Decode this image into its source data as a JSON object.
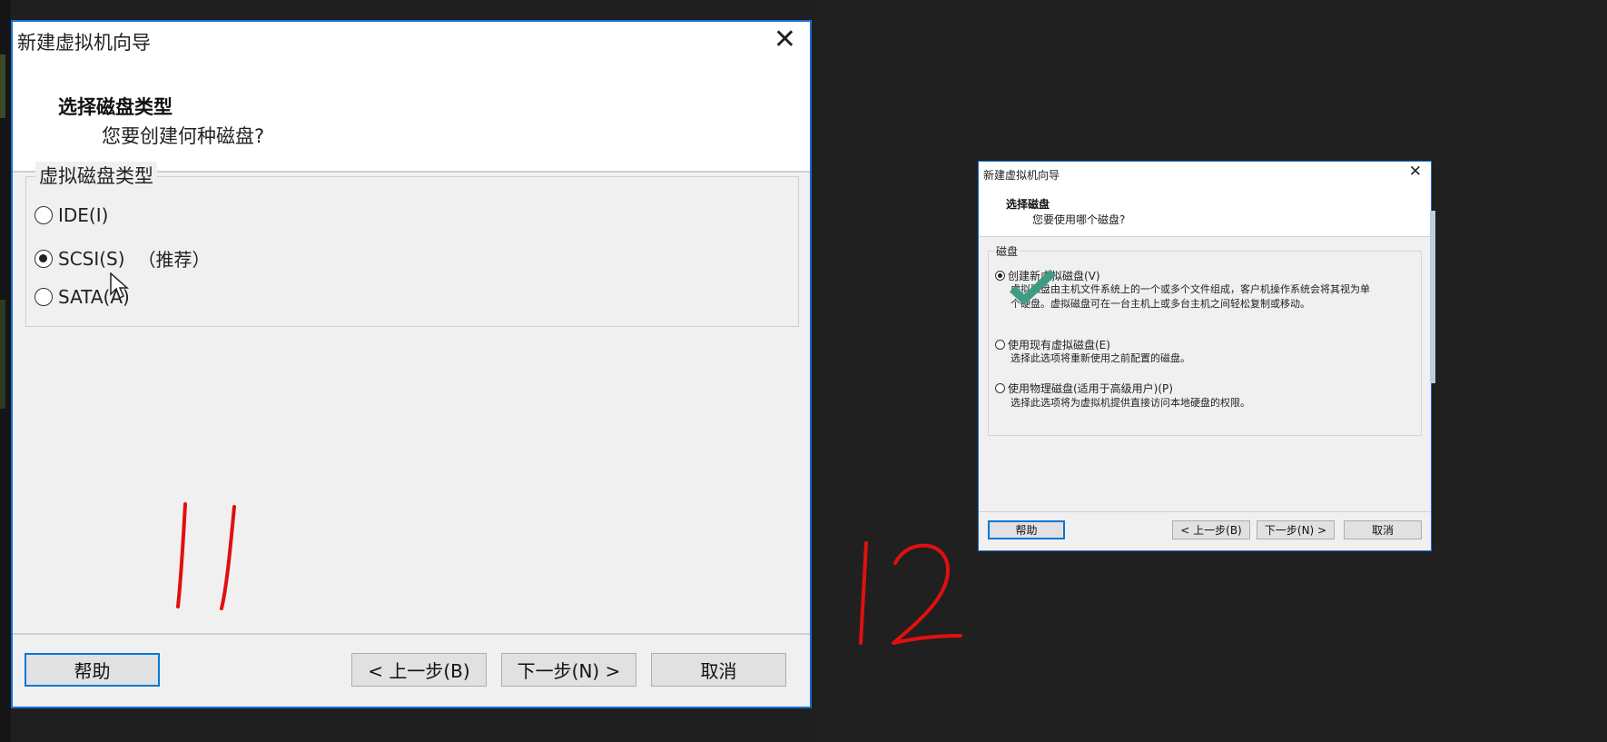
{
  "dialog1": {
    "title": "新建虚拟机向导",
    "header_title": "选择磁盘类型",
    "header_subtitle": "您要创建何种磁盘?",
    "group_label": "虚拟磁盘类型",
    "options": [
      {
        "label": "IDE(I)",
        "selected": false
      },
      {
        "label": "SCSI(S)",
        "selected": true,
        "suffix": "（推荐）"
      },
      {
        "label": "SATA(A)",
        "selected": false
      }
    ],
    "buttons": {
      "help": "帮助",
      "back": "< 上一步(B)",
      "next": "下一步(N) >",
      "cancel": "取消"
    }
  },
  "dialog2": {
    "title": "新建虚拟机向导",
    "header_title": "选择磁盘",
    "header_subtitle": "您要使用哪个磁盘?",
    "group_label": "磁盘",
    "options": [
      {
        "label": "创建新虚拟磁盘(V)",
        "selected": true,
        "desc1": "虚拟磁盘由主机文件系统上的一个或多个文件组成，客户机操作系统会将其视为单",
        "desc2": "个硬盘。虚拟磁盘可在一台主机上或多台主机之间轻松复制或移动。"
      },
      {
        "label": "使用现有虚拟磁盘(E)",
        "selected": false,
        "desc1": "选择此选项将重新使用之前配置的磁盘。"
      },
      {
        "label": "使用物理磁盘(适用于高级用户)(P)",
        "selected": false,
        "desc1": "选择此选项将为虚拟机提供直接访问本地硬盘的权限。"
      }
    ],
    "buttons": {
      "help": "帮助",
      "back": "< 上一步(B)",
      "next": "下一步(N) >",
      "cancel": "取消"
    }
  },
  "annotations": {
    "step_left": "11",
    "step_right": "12"
  },
  "colors": {
    "window_border": "#1a6fd0",
    "annotation": "#e01010",
    "checkmark": "#3f9a86"
  }
}
